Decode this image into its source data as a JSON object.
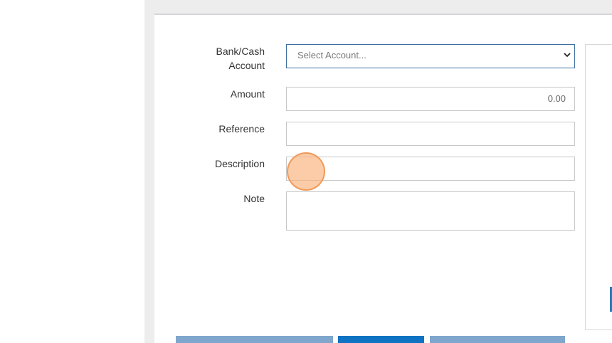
{
  "form": {
    "bank_cash_account": {
      "label_line1": "Bank/Cash",
      "label_line2": "Account",
      "selected": "Select Account..."
    },
    "amount": {
      "label": "Amount",
      "value": "0.00"
    },
    "reference": {
      "label": "Reference",
      "value": ""
    },
    "description": {
      "label": "Description",
      "value": ""
    },
    "note": {
      "label": "Note",
      "value": ""
    }
  },
  "icons": {
    "select_arrow": "chevron-down-icon"
  },
  "colors": {
    "primary_button": "#0d73c2",
    "secondary_button": "#7fa6cc",
    "focus_border": "#3d6fa0",
    "click_indicator": "#f9b078"
  }
}
